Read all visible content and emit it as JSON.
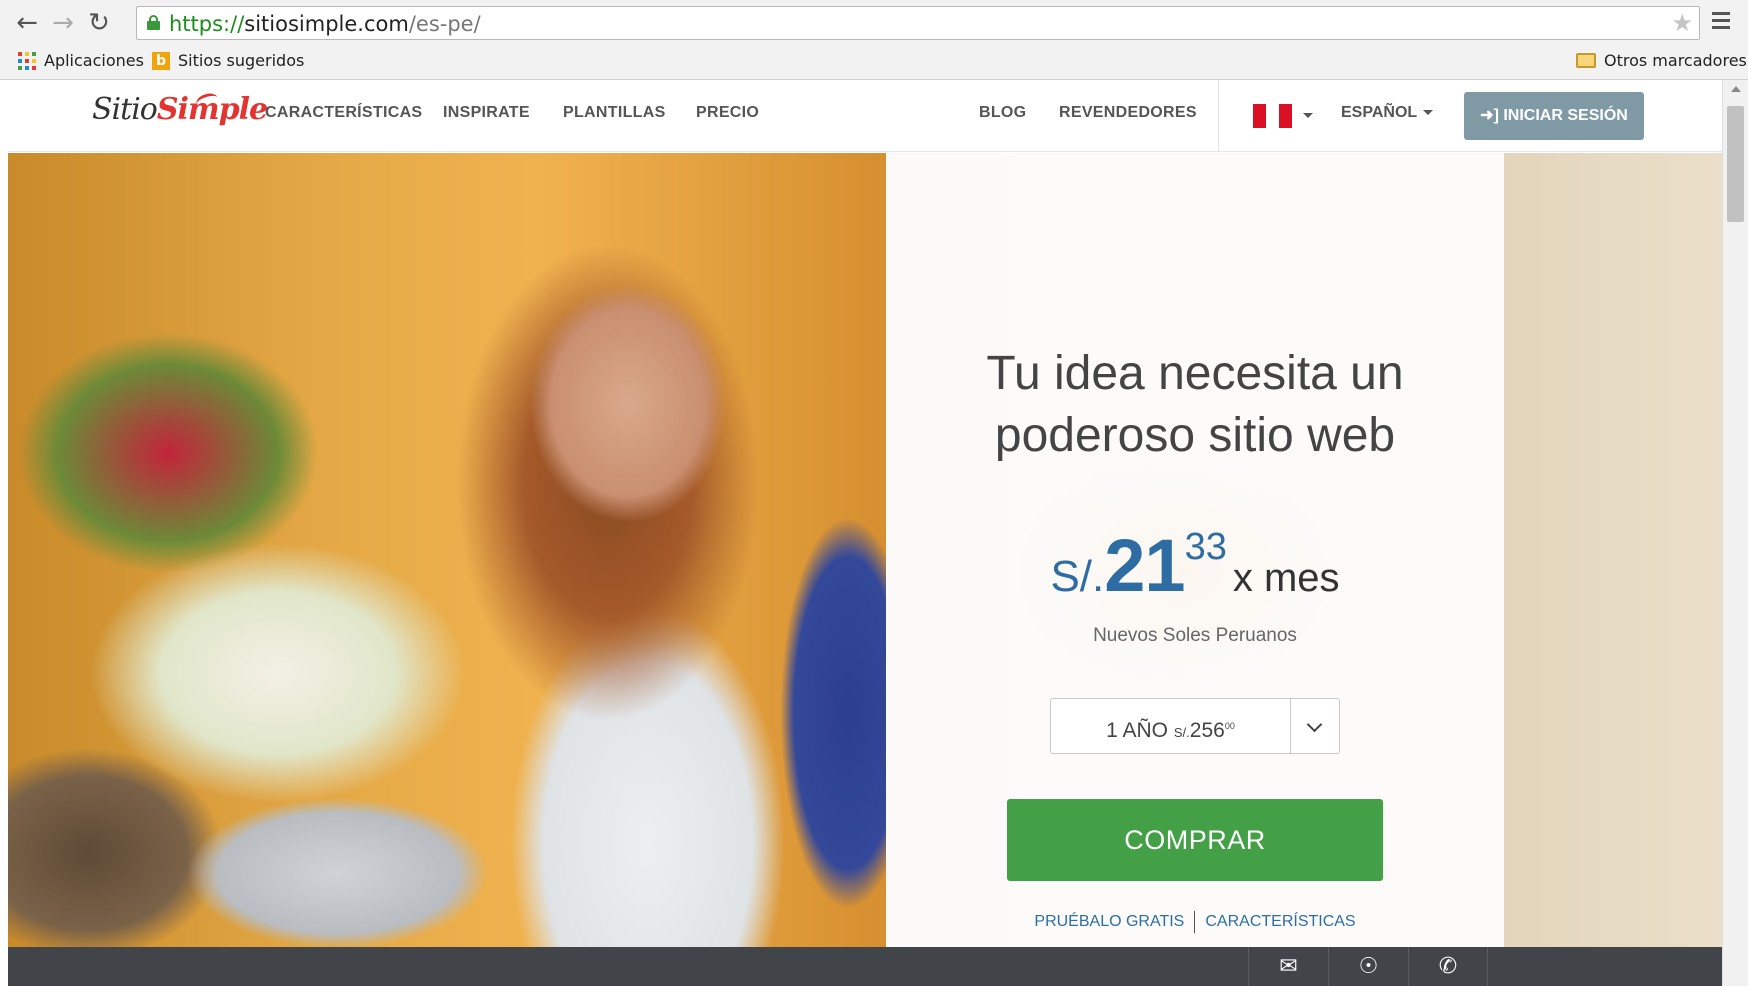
{
  "browser": {
    "url_protocol": "https://",
    "url_host": "sitiosimple.com",
    "url_path": "/es-pe/",
    "back_icon": "←",
    "forward_icon": "→",
    "reload_icon": "↻",
    "star_icon": "★",
    "bookmarks": {
      "apps": "Aplicaciones",
      "suggested": "Sitios sugeridos",
      "other": "Otros marcadores"
    }
  },
  "site": {
    "logo_part1": "Sitio",
    "logo_part2": "Simple",
    "nav": [
      "CARACTERÍSTICAS",
      "INSPIRATE",
      "PLANTILLAS",
      "PRECIO"
    ],
    "nav_right": [
      "BLOG",
      "REVENDEDORES"
    ],
    "language": "ESPAÑOL",
    "login": "➜] INICIAR SESIÓN",
    "flag_colors": [
      "#d91023",
      "#ffffff",
      "#d91023"
    ]
  },
  "hero": {
    "headline_line1": "Tu idea necesita un",
    "headline_line2": "poderoso sitio web",
    "price_currency": "S/.",
    "price_integer": "21",
    "price_decimal": "33",
    "price_period": "x mes",
    "price_subtitle": "Nuevos Soles Peruanos",
    "plan_label": "1 AÑO",
    "plan_currency": "S/.",
    "plan_amount": "256",
    "plan_cents": "00",
    "buy_button": "COMPRAR",
    "link_trial": "PRUÉBALO GRATIS",
    "link_features": "CARACTERÍSTICAS"
  },
  "bottom_bar": {
    "icons": [
      "chat-icon",
      "lifebuoy-icon",
      "phone-icon"
    ],
    "glyphs": [
      "✉",
      "☉",
      "✆"
    ]
  },
  "colors": {
    "primary_blue": "#2e6da4",
    "buy_green": "#43a047",
    "login_gray": "#7f9aa4",
    "logo_red": "#e3342f"
  }
}
